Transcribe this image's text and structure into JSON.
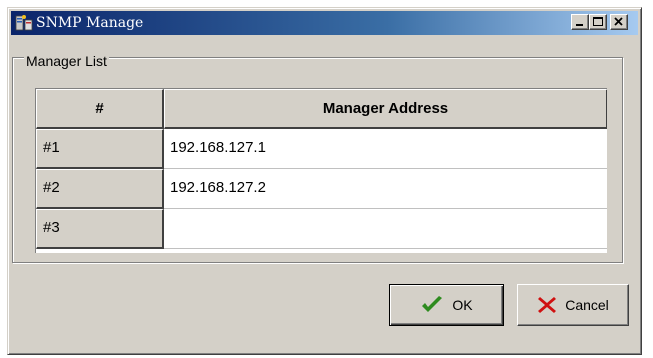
{
  "window": {
    "title": "SNMP Manage",
    "app_icon": "snmp-app-icon",
    "controls": {
      "minimize_icon": "minimize-icon",
      "maximize_icon": "maximize-icon",
      "close_icon": "close-icon"
    }
  },
  "group": {
    "label": "Manager List"
  },
  "table": {
    "columns": [
      "#",
      "Manager Address"
    ],
    "rows": [
      {
        "index": "#1",
        "address": "192.168.127.1"
      },
      {
        "index": "#2",
        "address": "192.168.127.2"
      },
      {
        "index": "#3",
        "address": ""
      }
    ]
  },
  "buttons": {
    "ok": {
      "label": "OK",
      "icon": "checkmark-icon",
      "icon_color": "#2e8b1f"
    },
    "cancel": {
      "label": "Cancel",
      "icon": "x-icon",
      "icon_color": "#d01010"
    }
  },
  "colors": {
    "dialog_face": "#d4d0c8",
    "title_gradient_start": "#0a246a",
    "title_gradient_end": "#a6caf0"
  }
}
